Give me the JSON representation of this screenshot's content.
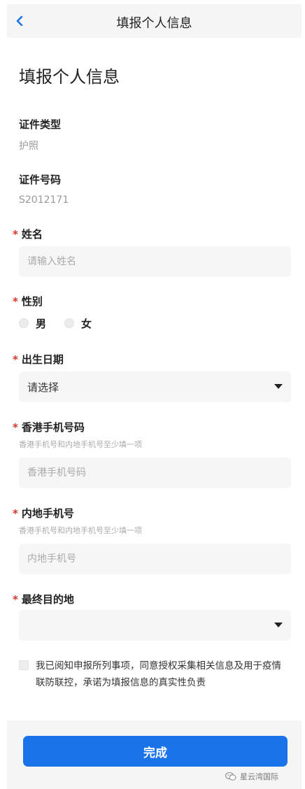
{
  "nav": {
    "title": "填报个人信息"
  },
  "heading": "填报个人信息",
  "required_mark": "*",
  "id_type": {
    "label": "证件类型",
    "value": "护照"
  },
  "id_number": {
    "label": "证件号码",
    "value": "S2012171"
  },
  "name": {
    "label": "姓名",
    "placeholder": "请输入姓名"
  },
  "gender": {
    "label": "性别",
    "options": [
      "男",
      "女"
    ]
  },
  "birth_date": {
    "label": "出生日期",
    "value": "请选择"
  },
  "hk_phone": {
    "label": "香港手机号码",
    "hint": "香港手机号和内地手机号至少填一项",
    "placeholder": "香港手机号码"
  },
  "mainland_phone": {
    "label": "内地手机号",
    "hint": "香港手机号和内地手机号至少填一项",
    "placeholder": "内地手机号"
  },
  "destination": {
    "label": "最终目的地",
    "value": ""
  },
  "consent": {
    "text": "我已阅知申报所列事项，同意授权采集相关信息及用于疫情联防联控，承诺为填报信息的真实性负责"
  },
  "submit": {
    "label": "完成"
  },
  "watermark": {
    "text": "星云湾国际"
  },
  "colors": {
    "primary": "#1a73e8",
    "required": "#d9342b",
    "nav_back": "#1a73e8"
  }
}
